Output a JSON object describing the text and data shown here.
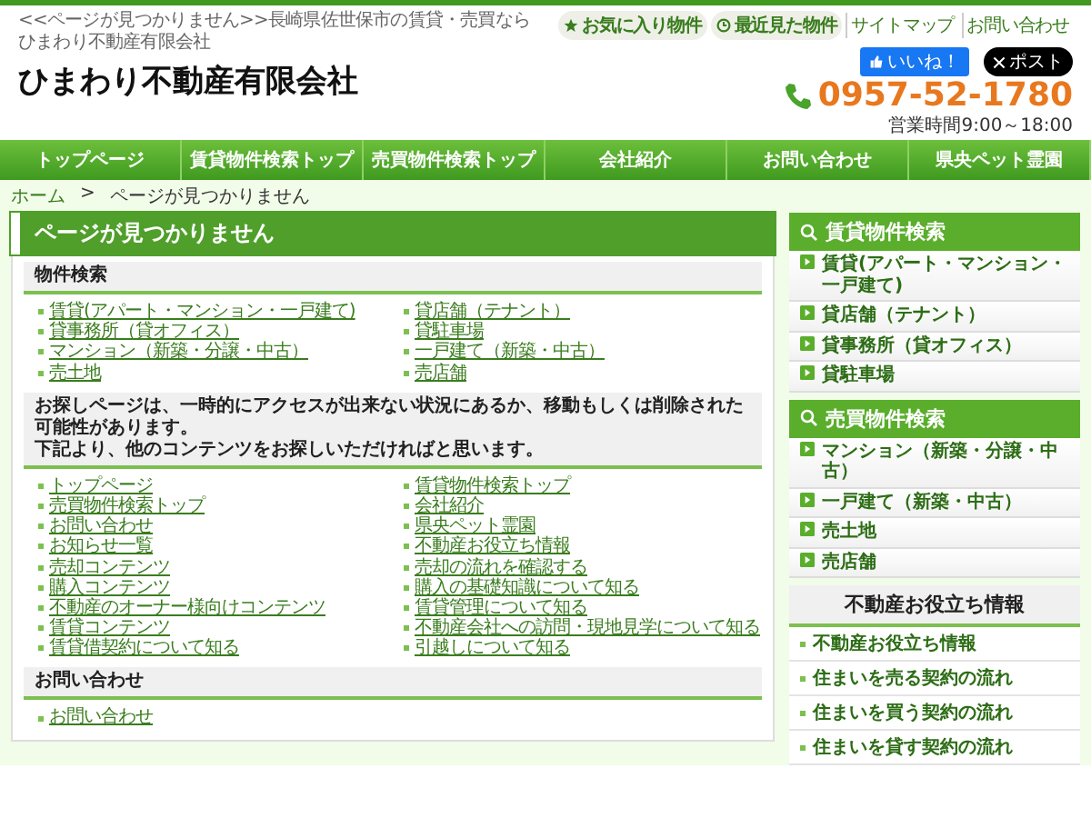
{
  "top_text": "<<ページが見つかりません>>長崎県佐世保市の賃貸・売買ならひまわり不動産有限会社",
  "header_links": [
    {
      "label": "お気に入り物件",
      "kind": "favorite"
    },
    {
      "label": "最近見た物件",
      "kind": "recent"
    },
    {
      "label": "サイトマップ",
      "kind": "plain"
    },
    {
      "label": "お問い合わせ",
      "kind": "plain"
    }
  ],
  "logo": "ひまわり不動産有限会社",
  "social": [
    {
      "label": "いいね！",
      "kind": "like"
    },
    {
      "label": "ポスト",
      "kind": "post"
    }
  ],
  "phone": "0957-52-1780",
  "hours": "営業時間9:00～18:00",
  "nav": [
    "トップページ",
    "賃貸物件検索トップ",
    "売買物件検索トップ",
    "会社紹介",
    "お問い合わせ",
    "県央ペット霊園"
  ],
  "breadcrumb": {
    "items": [
      "ホーム",
      "ページが見つかりません"
    ],
    "separator": ">"
  },
  "page_title": "ページが見つかりません",
  "sections": [
    {
      "heading": [
        "物件検索"
      ],
      "columns": [
        [
          "賃貸(アパート・マンション・一戸建て)",
          "貸事務所（貸オフィス）",
          "マンション（新築・分譲・中古）",
          "売土地"
        ],
        [
          "貸店舗（テナント）",
          "貸駐車場",
          "一戸建て（新築・中古）",
          "売店舗"
        ]
      ]
    },
    {
      "heading": [
        "お探しページは、一時的にアクセスが出来ない状況にあるか、移動もしくは削除された可能性があります。",
        "下記より、他のコンテンツをお探しいただければと思います。"
      ],
      "columns": [
        [
          "トップページ",
          "売買物件検索トップ",
          "お問い合わせ",
          "お知らせ一覧",
          "売却コンテンツ",
          "購入コンテンツ",
          "不動産のオーナー様向けコンテンツ",
          "賃貸コンテンツ",
          "賃貸借契約について知る"
        ],
        [
          "賃貸物件検索トップ",
          "会社紹介",
          "県央ペット霊園",
          "不動産お役立ち情報",
          "売却の流れを確認する",
          "購入の基礎知識について知る",
          "賃貸管理について知る",
          "不動産会社への訪問・現地見学について知る",
          "引越しについて知る"
        ]
      ]
    },
    {
      "heading": [
        "お問い合わせ"
      ],
      "columns": [
        [
          "お問い合わせ"
        ]
      ]
    }
  ],
  "search_panels": [
    {
      "title": "賃貸物件検索",
      "items": [
        "賃貸(アパート・マンション・一戸建て)",
        "貸店舗（テナント）",
        "貸事務所（貸オフィス）",
        "貸駐車場"
      ]
    },
    {
      "title": "売買物件検索",
      "items": [
        "マンション（新築・分譲・中古）",
        "一戸建て（新築・中古）",
        "売土地",
        "売店舗"
      ]
    }
  ],
  "info_panel": {
    "title": "不動産お役立ち情報",
    "items": [
      "不動産お役立ち情報",
      "住まいを売る契約の流れ",
      "住まいを買う契約の流れ",
      "住まいを貸す契約の流れ"
    ]
  }
}
